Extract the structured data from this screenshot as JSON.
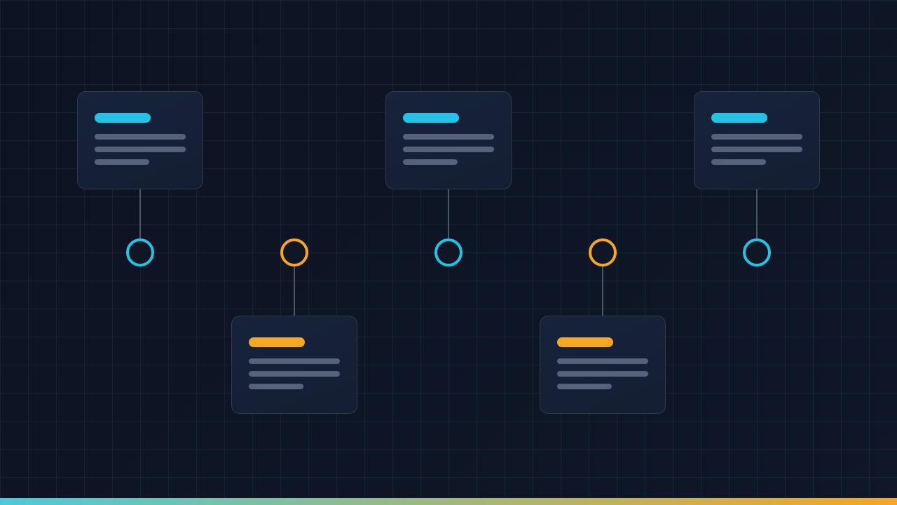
{
  "diagram": {
    "colors": {
      "primary": "#22c3e6",
      "secondary": "#f5a623",
      "card_line": "#56627a",
      "connector": "#4a5568",
      "bar_start": "#4cc9d9",
      "bar_end": "#f5a623"
    },
    "milestones": [
      {
        "id": "m1",
        "position": "above",
        "accent": "primary"
      },
      {
        "id": "m2",
        "position": "below",
        "accent": "secondary"
      },
      {
        "id": "m3",
        "position": "above",
        "accent": "primary"
      },
      {
        "id": "m4",
        "position": "below",
        "accent": "secondary"
      },
      {
        "id": "m5",
        "position": "above",
        "accent": "primary"
      }
    ]
  }
}
